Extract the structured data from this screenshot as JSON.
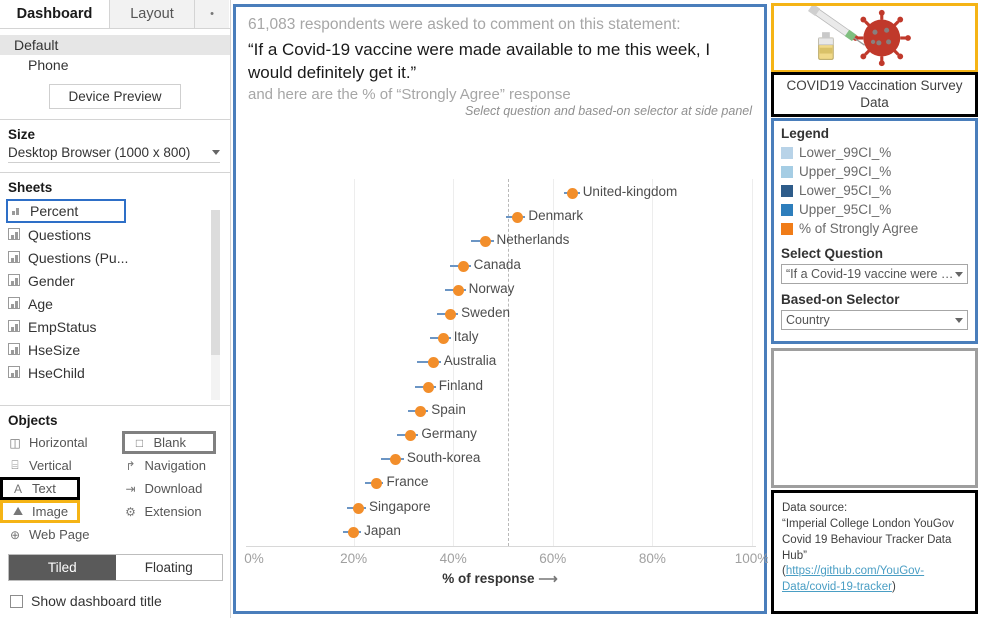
{
  "sidebar": {
    "tabs": [
      {
        "label": "Dashboard",
        "active": true
      },
      {
        "label": "Layout",
        "active": false
      }
    ],
    "tab_more": "•",
    "devices": [
      {
        "label": "Default",
        "selected": true
      },
      {
        "label": "Phone",
        "selected": false
      }
    ],
    "device_preview_label": "Device Preview",
    "size": {
      "heading": "Size",
      "value": "Desktop Browser (1000 x 800)"
    },
    "sheets": {
      "heading": "Sheets",
      "items": [
        {
          "label": "Percent",
          "highlighted": true
        },
        {
          "label": "Questions",
          "highlighted": false
        },
        {
          "label": "Questions (Pu...",
          "highlighted": false
        },
        {
          "label": "Gender",
          "highlighted": false
        },
        {
          "label": "Age",
          "highlighted": false
        },
        {
          "label": "EmpStatus",
          "highlighted": false
        },
        {
          "label": "HseSize",
          "highlighted": false
        },
        {
          "label": "HseChild",
          "highlighted": false
        }
      ]
    },
    "objects": {
      "heading": "Objects",
      "left": [
        {
          "label": "Horizontal",
          "icon": "horizontal-container-icon",
          "glyph": "◫",
          "box": "none"
        },
        {
          "label": "Vertical",
          "icon": "vertical-container-icon",
          "glyph": "⌸",
          "box": "none"
        },
        {
          "label": "Text",
          "icon": "text-icon",
          "glyph": "A",
          "box": "black"
        },
        {
          "label": "Image",
          "icon": "image-icon",
          "glyph": "⛰",
          "box": "gold"
        },
        {
          "label": "Web Page",
          "icon": "globe-icon",
          "glyph": "⊕",
          "box": "none"
        }
      ],
      "right": [
        {
          "label": "Blank",
          "icon": "blank-icon",
          "glyph": "□",
          "box": "gray"
        },
        {
          "label": "Navigation",
          "icon": "navigation-icon",
          "glyph": "↱",
          "box": "none"
        },
        {
          "label": "Download",
          "icon": "download-icon",
          "glyph": "⇥",
          "box": "none"
        },
        {
          "label": "Extension",
          "icon": "extension-icon",
          "glyph": "⚙",
          "box": "none"
        }
      ],
      "mode": {
        "tiled": "Tiled",
        "floating": "Floating",
        "active": "Tiled"
      },
      "show_dashboard_title": "Show dashboard title"
    }
  },
  "dashboard": {
    "intro_line": "61,083 respondents were asked to comment on this statement:",
    "quote": "“If a Covid-19 vaccine were made available to me this week, I would definitely get it.”",
    "sub_line": "and here are the % of “Strongly Agree” response",
    "hint": "Select question and based-on selector at side panel"
  },
  "chart_data": {
    "type": "scatter",
    "title": "",
    "xlabel": "% of response",
    "ylabel": "",
    "xlim": [
      0,
      100
    ],
    "xticks": [
      "0%",
      "20%",
      "40%",
      "60%",
      "80%",
      "100%"
    ],
    "xtick_values": [
      0,
      20,
      40,
      60,
      80,
      100
    ],
    "grid": true,
    "reference_line": 51,
    "categories": [
      "United-kingdom",
      "Denmark",
      "Netherlands",
      "Canada",
      "Norway",
      "Sweden",
      "Italy",
      "Australia",
      "Finland",
      "Spain",
      "Germany",
      "South-korea",
      "France",
      "Singapore",
      "Japan"
    ],
    "series": [
      {
        "name": "% of Strongly Agree",
        "values": [
          64.0,
          53.0,
          46.5,
          42.0,
          41.0,
          39.5,
          38.0,
          36.0,
          35.0,
          33.5,
          31.5,
          28.5,
          24.5,
          21.0,
          20.0
        ]
      },
      {
        "name": "Lower_95CI_%",
        "values": [
          62.3,
          50.6,
          43.5,
          39.4,
          38.4,
          36.7,
          35.3,
          32.8,
          32.4,
          31.0,
          28.8,
          25.5,
          22.2,
          18.7,
          17.8
        ]
      },
      {
        "name": "Upper_95CI_%",
        "values": [
          65.4,
          54.5,
          48.1,
          43.5,
          42.5,
          41.0,
          39.5,
          37.5,
          36.5,
          35.0,
          33.0,
          30.1,
          26.0,
          22.5,
          21.5
        ]
      }
    ]
  },
  "right_panel": {
    "image_alt": "covid19-vaccine-illustration",
    "title": "COVID19 Vaccination Survey Data",
    "legend": {
      "heading": "Legend",
      "items": [
        {
          "label": "Lower_99CI_%",
          "color": "#b8d3e8"
        },
        {
          "label": "Upper_99CI_%",
          "color": "#a5cde4"
        },
        {
          "label": "Lower_95CI_%",
          "color": "#2e5c8a"
        },
        {
          "label": "Upper_95CI_%",
          "color": "#2e7ebc"
        },
        {
          "label": "% of Strongly Agree",
          "color": "#f07c18"
        }
      ]
    },
    "select_question": {
      "label": "Select Question",
      "value": "“If a Covid-19 vaccine were …"
    },
    "based_on_selector": {
      "label": "Based-on Selector",
      "value": "Country"
    },
    "source": {
      "line1": "Data source:",
      "line2": "“Imperial College London YouGov Covid 19 Behaviour Tracker Data Hub”",
      "open_paren": "(",
      "link": "https://github.com/YouGov-Data/covid-19-tracker",
      "close_paren": ")"
    }
  }
}
